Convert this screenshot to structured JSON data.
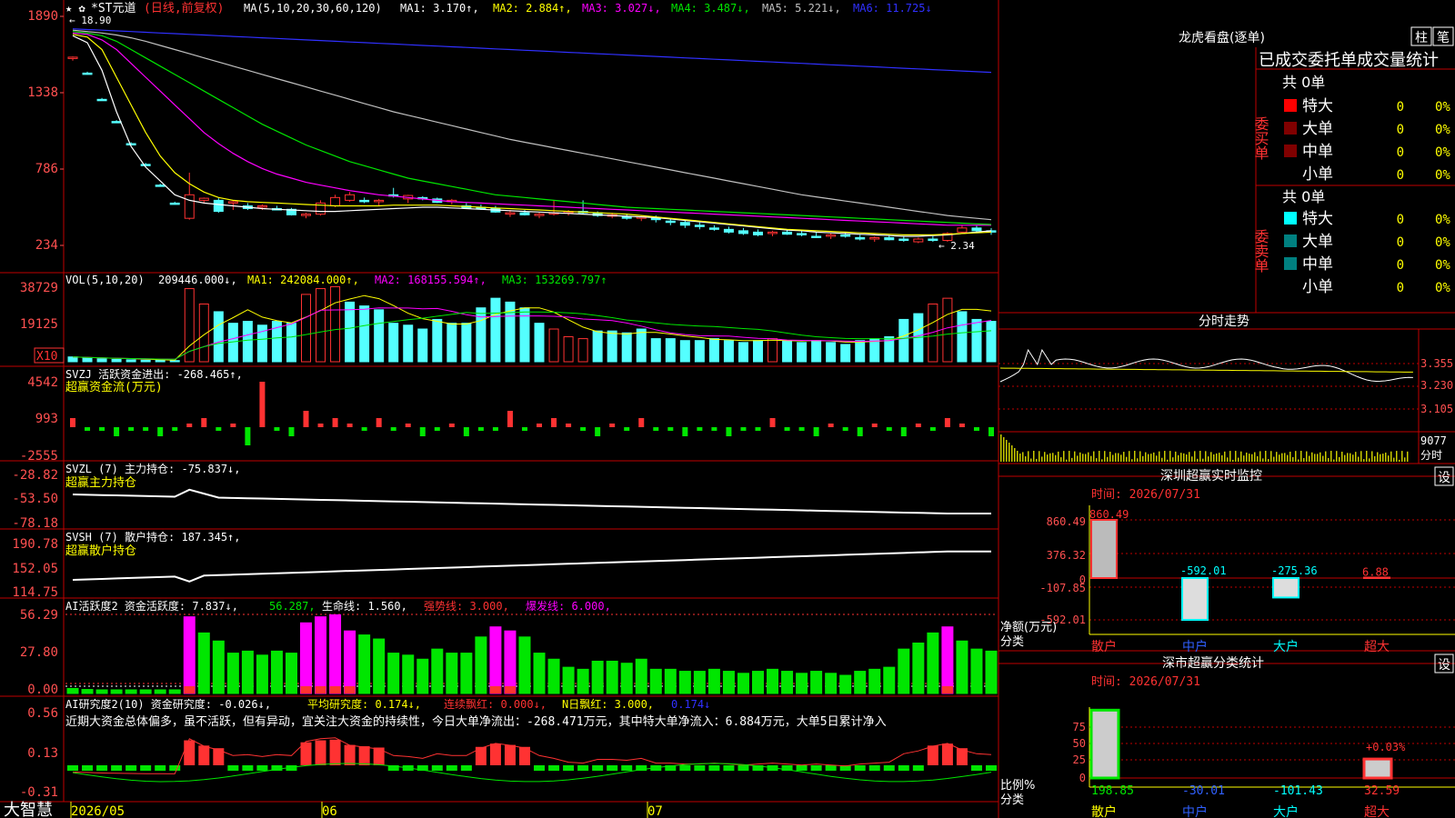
{
  "colors": {
    "bg": "#000000",
    "grid": "#c00000",
    "up": "#ff3232",
    "down": "#54ffff",
    "axis_text": "#ff5050",
    "white": "#ffffff",
    "yellow": "#ffff00",
    "magenta": "#ff00ff",
    "green": "#00e600",
    "gray": "#c0c0c0",
    "blue": "#3030ff",
    "teal": "#008080",
    "darkred": "#800000"
  },
  "header": {
    "stock_name": "*ST元道",
    "period": "(日线,前复权)",
    "ma_label": "MA(5,10,20,30,60,120)",
    "ma1": "MA1: 3.170↑,",
    "ma2": "MA2: 2.884↑,",
    "ma3": "MA3: 3.027↓,",
    "ma4": "MA4: 3.487↓,",
    "ma5": "MA5: 5.221↓,",
    "ma6": "MA6: 11.725↓",
    "high_marker": "← 18.90",
    "low_marker": "← 2.34",
    "star_icons": "★ ✿"
  },
  "vol_header": {
    "label": "VOL(5,10,20)",
    "value": "209446.000↓,",
    "ma1": "MA1: 242084.000↑,",
    "ma2": "MA2: 168155.594↑,",
    "ma3": "MA3: 153269.797↑",
    "unit": "X10"
  },
  "svzj_header": {
    "line1": "SVZJ  活跃资金进出: -268.465↑,",
    "line2": "超赢资金流(万元)"
  },
  "svzl_header": {
    "line1": "SVZL (7) 主力持仓: -75.837↓,",
    "line2": "超赢主力持仓"
  },
  "svsh_header": {
    "line1": "SVSH (7) 散户持仓: 187.345↑,",
    "line2": "超赢散户持仓"
  },
  "ai_header": {
    "a": "AI活跃度2 资金活跃度: 7.837↓,",
    "b": "56.287,",
    "c": "生命线: 1.560,",
    "d": "强势线: 3.000,",
    "e": "爆发线: 6.000,"
  },
  "ai2_header": {
    "a": "AI研究度2(10) 资金研究度: -0.026↓,",
    "b": "平均研究度: 0.174↓,",
    "c": "连续飘红: 0.000↓,",
    "d": "N日飘红: 3.000,",
    "e": "0.174↓"
  },
  "ai2_text": "近期大资金总体偏多，虽不活跃，但有异动，宜关注大资金的持续性，今日大单净流出：-268.471万元，其中特大单净流入：6.884万元，大单5日累计净入",
  "axis": {
    "price_ticks": [
      "1890",
      "1338",
      "786",
      "234"
    ],
    "vol_ticks": [
      "38729",
      "19125"
    ],
    "svzj_ticks": [
      "4542",
      "993",
      "-2555"
    ],
    "svzl_ticks": [
      "-28.82",
      "-53.50",
      "-78.18"
    ],
    "svsh_ticks": [
      "190.78",
      "152.05",
      "114.75"
    ],
    "ai_ticks": [
      "56.29",
      "27.80",
      "0.00"
    ],
    "ai2_ticks": [
      "0.56",
      "0.13",
      "-0.31"
    ],
    "date_ticks": [
      "2026/05",
      "06",
      "07"
    ],
    "brand": "大智慧"
  },
  "right_panel": {
    "title": "龙虎看盘(逐单)",
    "btn_col": "柱",
    "btn_pen": "笔",
    "header": "已成交委托单成交量统计",
    "buy_label": "委买单",
    "sell_label": "委卖单",
    "buy_total": "共 0单",
    "sell_total": "共 0单",
    "buy_rows": [
      {
        "name": "特大",
        "count": "0",
        "pct": "0%",
        "color": "#ff0000"
      },
      {
        "name": "大单",
        "count": "0",
        "pct": "0%",
        "color": "#800000"
      },
      {
        "name": "中单",
        "count": "0",
        "pct": "0%",
        "color": "#800000"
      },
      {
        "name": "小单",
        "count": "0",
        "pct": "0%",
        "color": ""
      }
    ],
    "sell_rows": [
      {
        "name": "特大",
        "count": "0",
        "pct": "0%",
        "color": "#00ffff"
      },
      {
        "name": "大单",
        "count": "0",
        "pct": "0%",
        "color": "#008080"
      },
      {
        "name": "中单",
        "count": "0",
        "pct": "0%",
        "color": "#008080"
      },
      {
        "name": "小单",
        "count": "0",
        "pct": "0%",
        "color": ""
      }
    ],
    "fenshi_title": "分时走势",
    "fenshi_ticks": [
      "3.355",
      "3.230",
      "3.105"
    ],
    "fenshi_vol_ticks": [
      "9077",
      "分时"
    ],
    "monitor_title": "深圳超赢实时监控",
    "monitor_set": "设",
    "monitor_time": "时间: 2026/07/31",
    "monitor_ticks": [
      "860.49",
      "376.32",
      "0",
      "-107.85",
      "-592.01"
    ],
    "monitor_values": [
      "860.49",
      "-592.01",
      "-275.36",
      "6.88"
    ],
    "monitor_left_label": "净额(万元)",
    "monitor_left_label2": "分类",
    "categories": [
      "散户",
      "中户",
      "大户",
      "超大"
    ],
    "class_title": "深市超赢分类统计",
    "class_set": "设",
    "class_time": "时间: 2026/07/31",
    "class_ticks": [
      "75",
      "50",
      "25",
      "0"
    ],
    "class_values": [
      "198.85",
      "-30.01",
      "-101.43",
      "32.59"
    ],
    "class_pct": "+0.03%",
    "class_left_label": "比例%",
    "class_left_label2": "分类"
  },
  "chart_data": {
    "type": "candlestick",
    "title": "*ST元道 (日线,前复权)",
    "x_ticks": [
      "2026/05",
      "06",
      "07"
    ],
    "price_axis": [
      1890,
      1338,
      786,
      234
    ],
    "candles": [
      [
        1590,
        1600,
        1570,
        1595
      ],
      [
        1480,
        1490,
        1470,
        1475
      ],
      [
        1290,
        1300,
        1280,
        1285
      ],
      [
        1130,
        1140,
        1120,
        1125
      ],
      [
        970,
        980,
        960,
        965
      ],
      [
        820,
        830,
        810,
        815
      ],
      [
        670,
        680,
        660,
        665
      ],
      [
        540,
        550,
        530,
        535
      ],
      [
        430,
        760,
        420,
        600
      ],
      [
        560,
        580,
        540,
        575
      ],
      [
        560,
        575,
        470,
        480
      ],
      [
        540,
        560,
        490,
        550
      ],
      [
        520,
        540,
        490,
        500
      ],
      [
        510,
        530,
        490,
        520
      ],
      [
        500,
        520,
        490,
        495
      ],
      [
        495,
        505,
        450,
        455
      ],
      [
        450,
        470,
        430,
        460
      ],
      [
        460,
        560,
        450,
        540
      ],
      [
        520,
        600,
        510,
        580
      ],
      [
        560,
        620,
        550,
        600
      ],
      [
        560,
        580,
        540,
        550
      ],
      [
        550,
        570,
        520,
        560
      ],
      [
        600,
        650,
        580,
        590
      ],
      [
        570,
        600,
        540,
        595
      ],
      [
        580,
        590,
        560,
        570
      ],
      [
        570,
        580,
        540,
        545
      ],
      [
        550,
        570,
        530,
        560
      ],
      [
        520,
        540,
        500,
        505
      ],
      [
        510,
        530,
        490,
        500
      ],
      [
        500,
        520,
        470,
        475
      ],
      [
        460,
        490,
        440,
        470
      ],
      [
        470,
        490,
        450,
        455
      ],
      [
        450,
        470,
        430,
        460
      ],
      [
        460,
        560,
        450,
        470
      ],
      [
        470,
        490,
        450,
        480
      ],
      [
        480,
        560,
        460,
        470
      ],
      [
        470,
        480,
        440,
        450
      ],
      [
        450,
        470,
        430,
        455
      ],
      [
        440,
        460,
        420,
        430
      ],
      [
        430,
        450,
        410,
        440
      ],
      [
        430,
        450,
        400,
        420
      ],
      [
        410,
        430,
        380,
        400
      ],
      [
        400,
        420,
        360,
        380
      ],
      [
        380,
        400,
        350,
        370
      ],
      [
        360,
        380,
        340,
        350
      ],
      [
        350,
        370,
        320,
        330
      ],
      [
        340,
        360,
        310,
        320
      ],
      [
        330,
        350,
        300,
        310
      ],
      [
        320,
        340,
        300,
        330
      ],
      [
        330,
        350,
        310,
        315
      ],
      [
        320,
        340,
        300,
        310
      ],
      [
        300,
        330,
        290,
        295
      ],
      [
        300,
        320,
        280,
        310
      ],
      [
        310,
        330,
        290,
        300
      ],
      [
        290,
        310,
        270,
        280
      ],
      [
        280,
        300,
        260,
        290
      ],
      [
        290,
        310,
        270,
        275
      ],
      [
        280,
        300,
        260,
        270
      ],
      [
        260,
        290,
        250,
        280
      ],
      [
        280,
        300,
        260,
        270
      ],
      [
        270,
        330,
        260,
        320
      ],
      [
        330,
        380,
        320,
        360
      ],
      [
        360,
        380,
        330,
        340
      ],
      [
        340,
        360,
        310,
        330
      ]
    ],
    "ma_lines": {
      "MA1": [
        1750,
        1700,
        1500,
        1200,
        950,
        800,
        700,
        600,
        560,
        540,
        530,
        520,
        510,
        500,
        495,
        490,
        485,
        480,
        480,
        485,
        490,
        495,
        500,
        505,
        510,
        510,
        505,
        500,
        495,
        490,
        485,
        480,
        475,
        470,
        465,
        460,
        455,
        450,
        445,
        440,
        435,
        425,
        415,
        405,
        395,
        385,
        375,
        365,
        355,
        345,
        340,
        330,
        325,
        320,
        315,
        310,
        305,
        300,
        300,
        305,
        310,
        320,
        330,
        340
      ],
      "MA2": [
        1760,
        1740,
        1650,
        1450,
        1250,
        1050,
        880,
        760,
        680,
        620,
        580,
        560,
        550,
        545,
        540,
        535,
        530,
        525,
        520,
        520,
        520,
        520,
        525,
        525,
        525,
        525,
        520,
        515,
        510,
        505,
        500,
        495,
        490,
        485,
        480,
        475,
        470,
        465,
        460,
        450,
        440,
        430,
        420,
        410,
        400,
        390,
        380,
        370,
        360,
        350,
        345,
        340,
        335,
        330,
        325,
        320,
        315,
        310,
        310,
        310,
        315,
        320,
        325,
        330
      ],
      "MA3": [
        1770,
        1760,
        1720,
        1650,
        1550,
        1450,
        1350,
        1250,
        1150,
        1050,
        970,
        900,
        840,
        790,
        750,
        720,
        690,
        670,
        650,
        630,
        615,
        600,
        590,
        580,
        570,
        560,
        550,
        545,
        540,
        535,
        530,
        525,
        520,
        515,
        510,
        505,
        500,
        495,
        490,
        485,
        480,
        475,
        470,
        465,
        460,
        455,
        450,
        445,
        440,
        435,
        430,
        425,
        420,
        415,
        410,
        405,
        400,
        395,
        390,
        385,
        380,
        380,
        380,
        380
      ],
      "MA4": [
        1780,
        1770,
        1750,
        1710,
        1650,
        1590,
        1530,
        1470,
        1410,
        1350,
        1290,
        1230,
        1170,
        1110,
        1060,
        1010,
        960,
        920,
        880,
        840,
        810,
        780,
        750,
        720,
        700,
        680,
        660,
        640,
        620,
        600,
        590,
        580,
        570,
        560,
        550,
        540,
        530,
        520,
        510,
        505,
        500,
        495,
        490,
        485,
        480,
        475,
        470,
        465,
        460,
        455,
        450,
        445,
        440,
        435,
        430,
        425,
        420,
        415,
        410,
        405,
        400,
        395,
        390,
        385
      ],
      "MA5": [
        1790,
        1780,
        1770,
        1755,
        1735,
        1710,
        1680,
        1650,
        1620,
        1590,
        1560,
        1530,
        1500,
        1470,
        1440,
        1410,
        1380,
        1350,
        1320,
        1290,
        1260,
        1230,
        1200,
        1175,
        1150,
        1125,
        1100,
        1075,
        1050,
        1025,
        1000,
        980,
        960,
        940,
        920,
        900,
        880,
        860,
        840,
        820,
        800,
        780,
        760,
        740,
        720,
        700,
        680,
        660,
        640,
        620,
        600,
        585,
        570,
        555,
        540,
        525,
        510,
        495,
        480,
        465,
        450,
        440,
        430,
        420
      ],
      "MA6": [
        1800,
        1795,
        1790,
        1785,
        1780,
        1775,
        1770,
        1765,
        1760,
        1755,
        1750,
        1745,
        1740,
        1735,
        1730,
        1725,
        1720,
        1715,
        1710,
        1705,
        1700,
        1695,
        1690,
        1685,
        1680,
        1675,
        1670,
        1665,
        1660,
        1655,
        1650,
        1645,
        1640,
        1635,
        1630,
        1625,
        1620,
        1615,
        1610,
        1605,
        1600,
        1595,
        1590,
        1585,
        1580,
        1575,
        1570,
        1565,
        1560,
        1555,
        1550,
        1545,
        1540,
        1535,
        1530,
        1525,
        1520,
        1515,
        1510,
        1505,
        1500,
        1495,
        1490,
        1485
      ]
    },
    "volume": [
      2500,
      2000,
      1500,
      1200,
      1000,
      800,
      700,
      600,
      38000,
      30000,
      26000,
      20000,
      21000,
      19000,
      21000,
      20000,
      35000,
      38000,
      39000,
      31000,
      29000,
      27000,
      20000,
      19000,
      17000,
      22000,
      20000,
      20000,
      28000,
      33000,
      31000,
      28000,
      20000,
      17000,
      13000,
      12000,
      16000,
      16000,
      15000,
      17000,
      12000,
      12000,
      11000,
      11000,
      12000,
      11000,
      10000,
      11000,
      12000,
      11000,
      10000,
      11000,
      10000,
      9000,
      11000,
      12000,
      13000,
      22000,
      25000,
      30000,
      33000,
      26000,
      22000,
      21000
    ],
    "vol_up": [
      false,
      false,
      false,
      false,
      false,
      false,
      false,
      false,
      true,
      true,
      false,
      false,
      false,
      false,
      false,
      false,
      true,
      true,
      true,
      false,
      false,
      false,
      false,
      false,
      false,
      false,
      false,
      false,
      false,
      false,
      false,
      false,
      false,
      true,
      true,
      true,
      false,
      false,
      false,
      false,
      false,
      false,
      false,
      false,
      false,
      false,
      false,
      false,
      true,
      false,
      false,
      false,
      false,
      false,
      false,
      false,
      false,
      false,
      false,
      true,
      true,
      false,
      false,
      false
    ]
  }
}
